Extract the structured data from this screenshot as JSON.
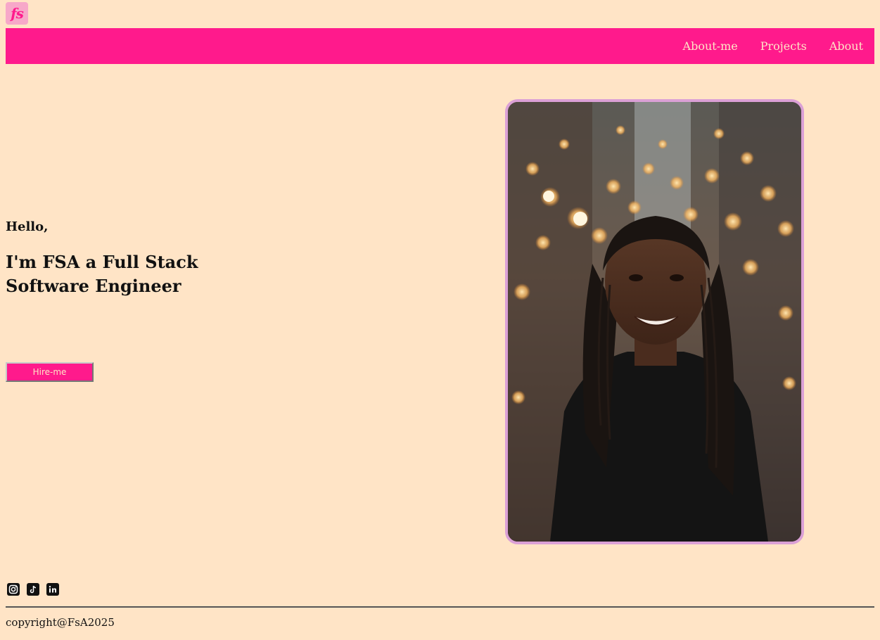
{
  "logo": {
    "text": "fs"
  },
  "nav": {
    "items": [
      {
        "label": "About-me"
      },
      {
        "label": "Projects"
      },
      {
        "label": "About"
      }
    ]
  },
  "hero": {
    "greeting": "Hello,",
    "headline": "I'm FSA a Full Stack Software Engineer",
    "cta_label": "Hire-me",
    "portrait_icon": "photo-portrait"
  },
  "socials": [
    {
      "icon": "instagram-icon"
    },
    {
      "icon": "tiktok-icon"
    },
    {
      "icon": "linkedin-icon"
    }
  ],
  "footer": {
    "copyright": "copyright@FsA2025"
  },
  "colors": {
    "background": "#ffe4c6",
    "accent": "#ff1a8c",
    "frame": "#dba0d6",
    "text": "#111111"
  }
}
